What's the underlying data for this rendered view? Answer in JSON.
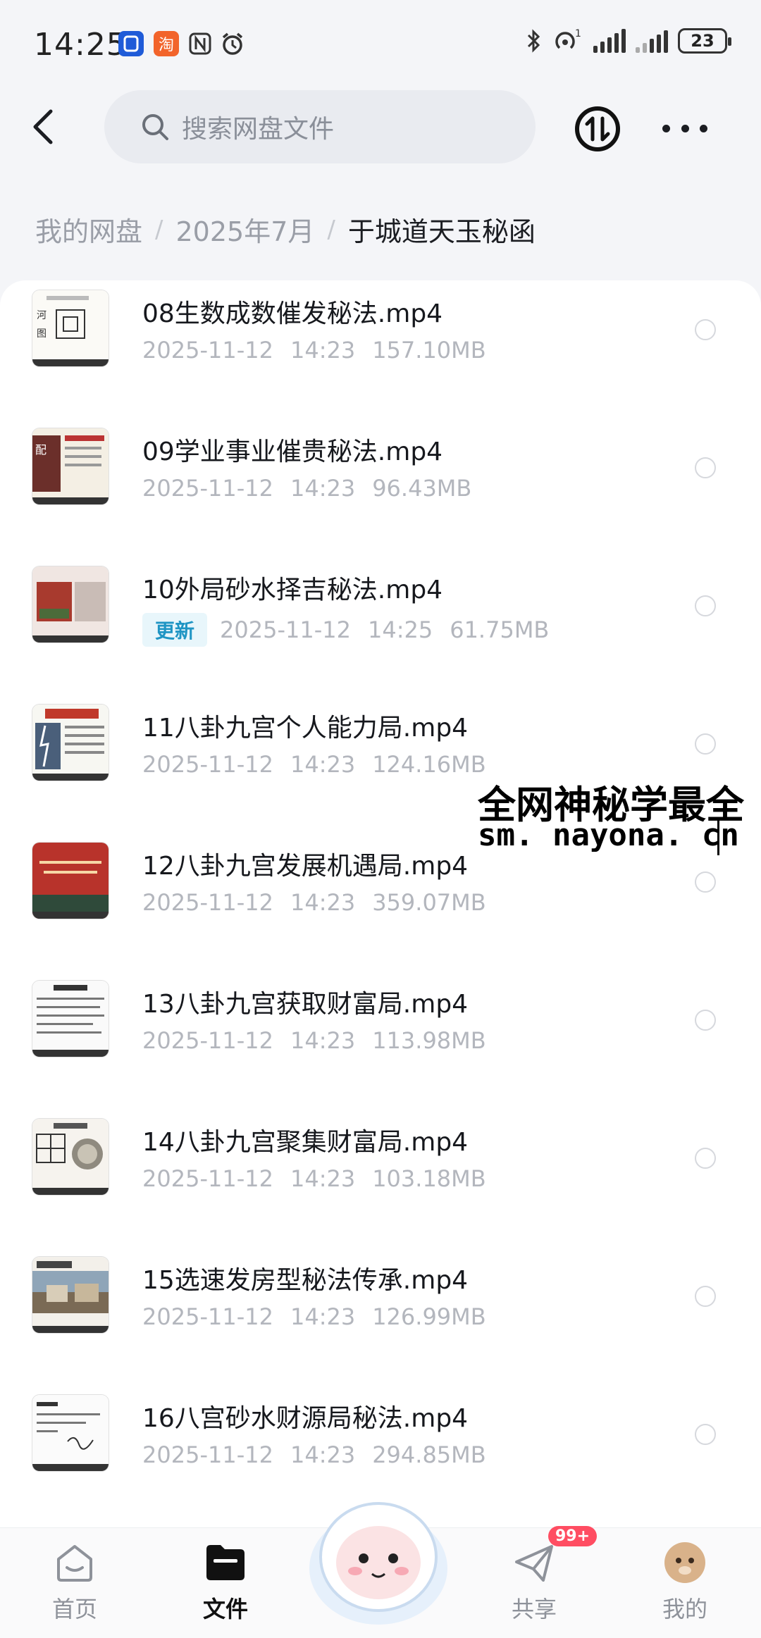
{
  "status_bar": {
    "time": "14:25",
    "app_icons": [
      "notification-app-icon-blue",
      "taobao-app-icon",
      "nfc-icon",
      "alarm-icon"
    ],
    "battery": "23",
    "signal_icons": [
      "bluetooth-icon",
      "hotspot-icon",
      "signal-icon",
      "signal-icon-2"
    ]
  },
  "header": {
    "search_placeholder": "搜索网盘文件"
  },
  "breadcrumb": {
    "items": [
      "我的网盘",
      "2025年7月",
      "于城道天玉秘函"
    ]
  },
  "files": [
    {
      "name": "08生数成数催发秘法.mp4",
      "date": "2025-11-12",
      "time": "14:23",
      "size": "157.10MB",
      "badge": ""
    },
    {
      "name": "09学业事业催贵秘法.mp4",
      "date": "2025-11-12",
      "time": "14:23",
      "size": "96.43MB",
      "badge": ""
    },
    {
      "name": "10外局砂水择吉秘法.mp4",
      "date": "2025-11-12",
      "time": "14:25",
      "size": "61.75MB",
      "badge": "更新"
    },
    {
      "name": "11八卦九宫个人能力局.mp4",
      "date": "2025-11-12",
      "time": "14:23",
      "size": "124.16MB",
      "badge": ""
    },
    {
      "name": "12八卦九宫发展机遇局.mp4",
      "date": "2025-11-12",
      "time": "14:23",
      "size": "359.07MB",
      "badge": ""
    },
    {
      "name": "13八卦九宫获取财富局.mp4",
      "date": "2025-11-12",
      "time": "14:23",
      "size": "113.98MB",
      "badge": ""
    },
    {
      "name": "14八卦九宫聚集财富局.mp4",
      "date": "2025-11-12",
      "time": "14:23",
      "size": "103.18MB",
      "badge": ""
    },
    {
      "name": "15选速发房型秘法传承.mp4",
      "date": "2025-11-12",
      "time": "14:23",
      "size": "126.99MB",
      "badge": ""
    },
    {
      "name": "16八宫砂水财源局秘法.mp4",
      "date": "2025-11-12",
      "time": "14:23",
      "size": "294.85MB",
      "badge": ""
    }
  ],
  "watermark": {
    "line1": "全网神秘学最全",
    "line2": "sm. nayona. cn"
  },
  "bottom_nav": {
    "items": [
      {
        "label": "首页",
        "icon": "home-icon"
      },
      {
        "label": "文件",
        "icon": "folder-icon"
      },
      {
        "label": "共享",
        "icon": "share-icon"
      },
      {
        "label": "我的",
        "icon": "avatar-icon"
      }
    ],
    "active": "文件",
    "share_badge": "99+"
  },
  "colors": {
    "accent": "#1f95c4",
    "badge_red": "#ff4d62",
    "meta_gray": "#b3b6bd"
  }
}
